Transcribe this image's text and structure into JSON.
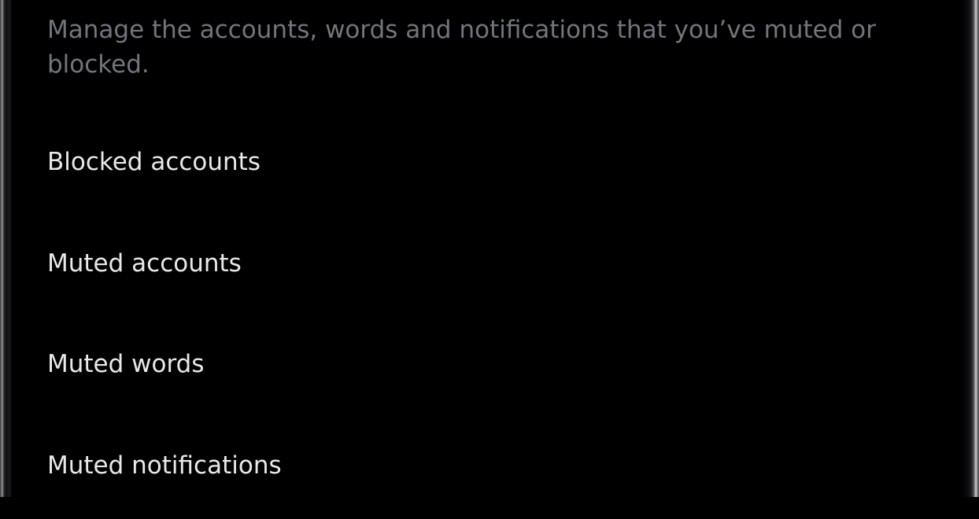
{
  "settings": {
    "description": "Manage the accounts, words and notifications that you’ve muted or blocked.",
    "items": [
      {
        "label": "Blocked accounts"
      },
      {
        "label": "Muted accounts"
      },
      {
        "label": "Muted words"
      },
      {
        "label": "Muted notifications"
      }
    ]
  },
  "colors": {
    "background": "#000000",
    "primary_text": "#e7e9ea",
    "secondary_text": "#71767b"
  }
}
